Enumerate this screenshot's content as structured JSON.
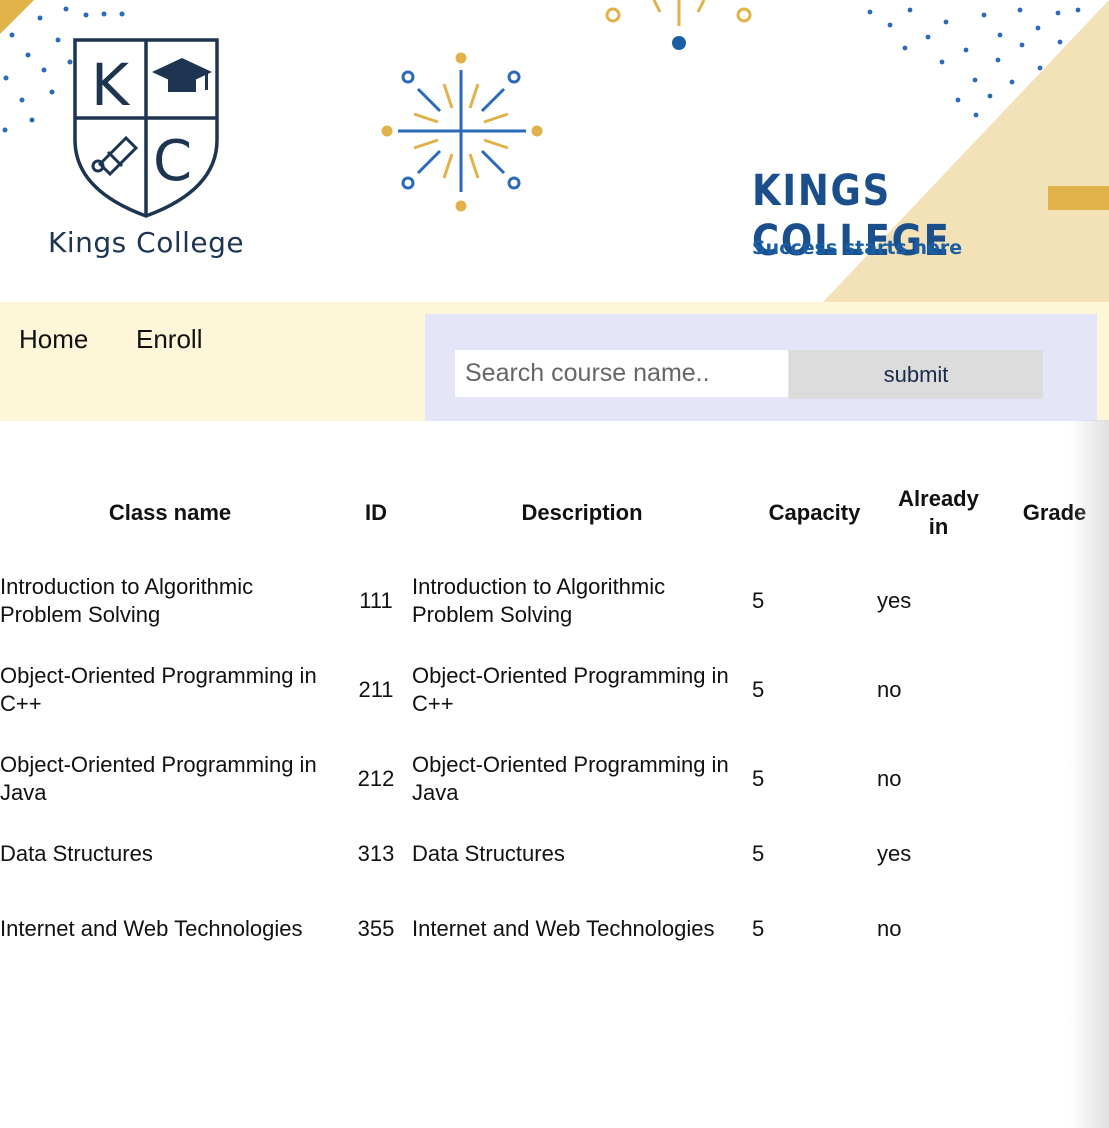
{
  "header": {
    "logo_letters": [
      "K",
      "C"
    ],
    "logo_text": "Kings College",
    "brand_title": "KINGS COLLEGE",
    "brand_tagline": "Success starts here"
  },
  "nav": {
    "links": [
      {
        "label": "Home"
      },
      {
        "label": "Enroll"
      }
    ]
  },
  "search": {
    "placeholder": "Search course name..",
    "value": "",
    "button_label": "submit"
  },
  "table": {
    "headers": {
      "class_name": "Class name",
      "id": "ID",
      "description": "Description",
      "capacity": "Capacity",
      "already_in": "Already in",
      "grade": "Grade"
    },
    "rows": [
      {
        "class_name": "Introduction to Algorithmic Problem Solving",
        "id": "111",
        "description": "Introduction to Algorithmic Problem Solving",
        "capacity": "5",
        "already_in": "yes",
        "grade": ""
      },
      {
        "class_name": "Object-Oriented Programming in C++",
        "id": "211",
        "description": "Object-Oriented Programming in C++",
        "capacity": "5",
        "already_in": "no",
        "grade": ""
      },
      {
        "class_name": "Object-Oriented Programming in Java",
        "id": "212",
        "description": "Object-Oriented Programming in Java",
        "capacity": "5",
        "already_in": "no",
        "grade": ""
      },
      {
        "class_name": "Data Structures",
        "id": "313",
        "description": "Data Structures",
        "capacity": "5",
        "already_in": "yes",
        "grade": ""
      },
      {
        "class_name": "Internet and Web Technologies",
        "id": "355",
        "description": "Internet and Web Technologies",
        "capacity": "5",
        "already_in": "no",
        "grade": ""
      }
    ]
  },
  "colors": {
    "navy": "#1d3550",
    "brand_blue": "#1a4f8b",
    "gold": "#e2b24a",
    "nav_bg": "#fdf6d9",
    "search_bg": "#e5e5fa",
    "button_bg": "#dcdcdc"
  }
}
